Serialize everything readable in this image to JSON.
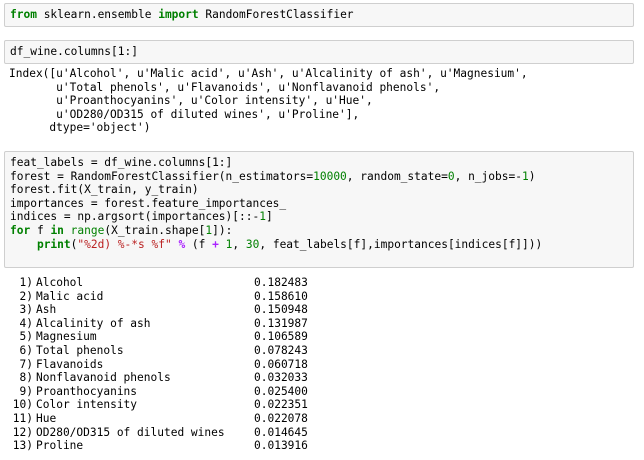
{
  "cell1": {
    "kw_from": "from",
    "module": " sklearn.ensemble ",
    "kw_import": "import",
    "cls": " RandomForestClassifier"
  },
  "cell2": {
    "code": "df_wine.columns[1:]"
  },
  "output2": {
    "lines": [
      "Index([u'Alcohol', u'Malic acid', u'Ash', u'Alcalinity of ash', u'Magnesium',",
      "       u'Total phenols', u'Flavanoids', u'Nonflavanoid phenols',",
      "       u'Proanthocyanins', u'Color intensity', u'Hue',",
      "       u'OD280/OD315 of diluted wines', u'Proline'],",
      "      dtype='object')"
    ]
  },
  "cell3": {
    "l1": "feat_labels = df_wine.columns[1:]",
    "l2_a": "forest = RandomForestClassifier(n_estimators=",
    "l2_n1": "10000",
    "l2_b": ", random_state=",
    "l2_n2": "0",
    "l2_c": ", n_jobs=-",
    "l2_n3": "1",
    "l2_d": ")",
    "l3": "forest.fit(X_train, y_train)",
    "l4": "importances = forest.feature_importances_",
    "l5_a": "indices = np.argsort(importances)[::-",
    "l5_n": "1",
    "l5_b": "]",
    "l6_for": "for",
    "l6_a": " f ",
    "l6_in": "in",
    "l6_sp": " ",
    "l6_range": "range",
    "l6_b": "(X_train.shape[",
    "l6_n": "1",
    "l6_c": "]):",
    "l7_indent": "    ",
    "l7_print": "print",
    "l7_a": "(",
    "l7_str": "\"%2d) %-*s %f\"",
    "l7_sp": " ",
    "l7_pct": "%",
    "l7_b": " (f ",
    "l7_plus": "+",
    "l7_sp2": " ",
    "l7_n1": "1",
    "l7_c": ", ",
    "l7_n2": "30",
    "l7_d": ", feat_labels[f],importances[indices[f]]))"
  },
  "output3": {
    "rows": [
      {
        "idx": "1)",
        "name": "Alcohol",
        "value": "0.182483"
      },
      {
        "idx": "2)",
        "name": "Malic acid",
        "value": "0.158610"
      },
      {
        "idx": "3)",
        "name": "Ash",
        "value": "0.150948"
      },
      {
        "idx": "4)",
        "name": "Alcalinity of ash",
        "value": "0.131987"
      },
      {
        "idx": "5)",
        "name": "Magnesium",
        "value": "0.106589"
      },
      {
        "idx": "6)",
        "name": "Total phenols",
        "value": "0.078243"
      },
      {
        "idx": "7)",
        "name": "Flavanoids",
        "value": "0.060718"
      },
      {
        "idx": "8)",
        "name": "Nonflavanoid phenols",
        "value": "0.032033"
      },
      {
        "idx": "9)",
        "name": "Proanthocyanins",
        "value": "0.025400"
      },
      {
        "idx": "10)",
        "name": "Color intensity",
        "value": "0.022351"
      },
      {
        "idx": "11)",
        "name": "Hue",
        "value": "0.022078"
      },
      {
        "idx": "12)",
        "name": "OD280/OD315 of diluted wines",
        "value": "0.014645"
      },
      {
        "idx": "13)",
        "name": "Proline",
        "value": "0.013916"
      }
    ]
  }
}
